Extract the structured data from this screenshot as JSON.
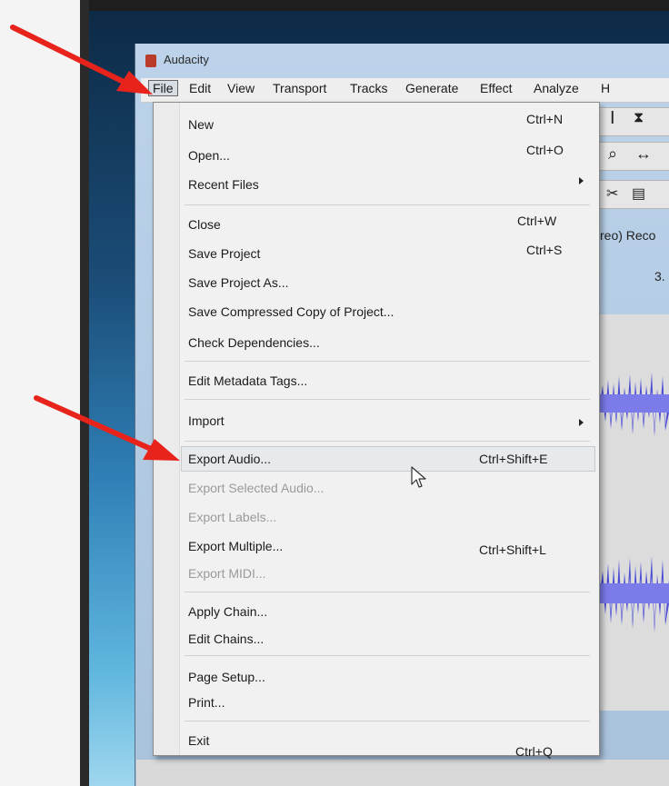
{
  "window": {
    "title": "Audacity"
  },
  "menubar": {
    "items": [
      {
        "label": "File",
        "active": true
      },
      {
        "label": "Edit"
      },
      {
        "label": "View"
      },
      {
        "label": "Transport"
      },
      {
        "label": "Tracks"
      },
      {
        "label": "Generate"
      },
      {
        "label": "Effect"
      },
      {
        "label": "Analyze"
      },
      {
        "label": "H"
      }
    ]
  },
  "background": {
    "track_label": "reo) Reco",
    "ruler_value": "3."
  },
  "file_menu": {
    "items": [
      {
        "label": "New",
        "shortcut": "Ctrl+N"
      },
      {
        "label": "Open...",
        "shortcut": "Ctrl+O"
      },
      {
        "label": "Recent Files",
        "submenu": true
      },
      {
        "label": "Close",
        "shortcut": "Ctrl+W"
      },
      {
        "label": "Save Project",
        "shortcut": "Ctrl+S"
      },
      {
        "label": "Save Project As..."
      },
      {
        "label": "Save Compressed Copy of Project..."
      },
      {
        "label": "Check Dependencies..."
      },
      {
        "label": "Edit Metadata Tags..."
      },
      {
        "label": "Import",
        "submenu": true
      },
      {
        "label": "Export Audio...",
        "shortcut": "Ctrl+Shift+E",
        "highlighted": true
      },
      {
        "label": "Export Selected Audio...",
        "disabled": true
      },
      {
        "label": "Export Labels...",
        "disabled": true
      },
      {
        "label": "Export Multiple...",
        "shortcut": "Ctrl+Shift+L"
      },
      {
        "label": "Export MIDI...",
        "disabled": true
      },
      {
        "label": "Apply Chain..."
      },
      {
        "label": "Edit Chains..."
      },
      {
        "label": "Page Setup..."
      },
      {
        "label": "Print..."
      },
      {
        "label": "Exit",
        "shortcut": "Ctrl+Q"
      }
    ]
  },
  "icons": {
    "arrow_color": "#e8231c",
    "cursor": "mouse-pointer-icon"
  }
}
